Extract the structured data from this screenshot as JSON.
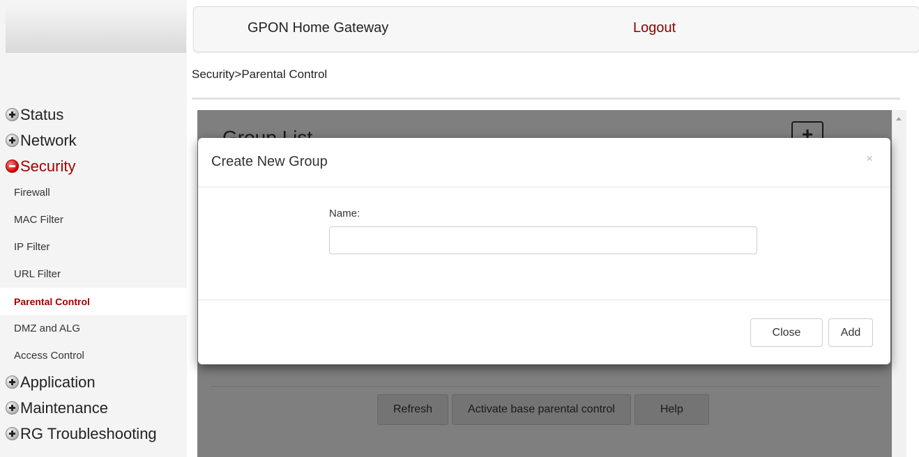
{
  "header": {
    "title": "GPON Home Gateway",
    "logout": "Logout"
  },
  "breadcrumb": "Security>Parental Control",
  "sidebar": {
    "items": [
      {
        "label": "Status",
        "expanded": false
      },
      {
        "label": "Network",
        "expanded": false
      },
      {
        "label": "Security",
        "expanded": true,
        "children": [
          "Firewall",
          "MAC Filter",
          "IP Filter",
          "URL Filter",
          "Parental Control",
          "DMZ and ALG",
          "Access Control"
        ],
        "active_child": "Parental Control"
      },
      {
        "label": "Application",
        "expanded": false
      },
      {
        "label": "Maintenance",
        "expanded": false
      },
      {
        "label": "RG Troubleshooting",
        "expanded": false
      }
    ]
  },
  "content": {
    "title": "Group List",
    "add_symbol": "+",
    "buttons": {
      "refresh": "Refresh",
      "activate": "Activate base parental control",
      "help": "Help"
    }
  },
  "modal": {
    "title": "Create New Group",
    "close_symbol": "×",
    "name_label": "Name:",
    "name_value": "",
    "close_button": "Close",
    "add_button": "Add"
  },
  "colors": {
    "accent": "#a10000",
    "logout": "#8b0000",
    "overlay": "rgba(0,0,0,0.5)"
  }
}
